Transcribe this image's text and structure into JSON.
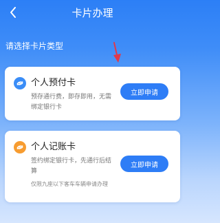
{
  "header": {
    "title": "卡片办理",
    "back_icon": "chevron-left-icon"
  },
  "subtitle": "请选择卡片类型",
  "annotation": {
    "arrow_icon": "arrow-down-icon",
    "arrow_color": "#e0394a"
  },
  "cards": [
    {
      "title": "个人预付卡",
      "description": "预存通行费，即存即用，无需绑定银行卡",
      "button_label": "立即申请",
      "icon": "swirl-icon",
      "icon_color": "#3a8df7"
    },
    {
      "title": "个人记账卡",
      "description": "签约绑定银行卡，先通行后结算",
      "button_label": "立即申请",
      "note": "仅限九座以下客车车辆申请办理",
      "icon": "swirl-icon",
      "icon_color": "#f79c30"
    }
  ],
  "colors": {
    "accent": "#2e7df6"
  }
}
